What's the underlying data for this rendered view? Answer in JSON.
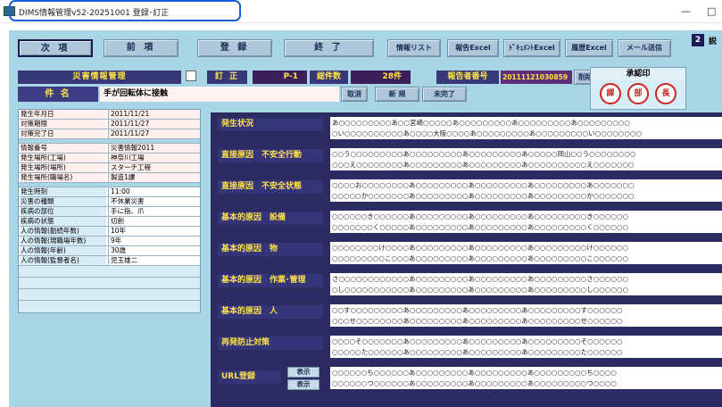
{
  "window": {
    "title": "DIMS情報管理v52-20251001 登録･訂正",
    "minimize": "—",
    "maximize": "□"
  },
  "toolbar": {
    "next": "次 項",
    "prev": "前 項",
    "register": "登 録",
    "end": "終 了",
    "info_list": "情報リスト",
    "report_excel": "報告Excel",
    "document_excel": "ﾄﾞｷｭﾒﾝﾄExcel",
    "history_excel": "履歴Excel",
    "send_mail": "メール送信",
    "badge": "2",
    "side_label": "説"
  },
  "header": {
    "title": "災害情報管理",
    "correct_label": "訂 正",
    "page": "P-1",
    "total_label": "総件数",
    "total_value": "28件",
    "report_no_label": "報告者番号",
    "report_no_value": "20111121030859",
    "delete_button": "削除"
  },
  "approval": {
    "title": "承認印",
    "stamps": [
      "課",
      "部",
      "長"
    ]
  },
  "subject": {
    "label": "件 名",
    "value": "手が回転体に接触",
    "cancel": "取消",
    "new": "新 規",
    "incomplete": "未完了"
  },
  "info": {
    "dates": [
      {
        "key": "発生年月日",
        "value": "2011/11/21"
      },
      {
        "key": "対策期限",
        "value": "2011/11/27"
      },
      {
        "key": "対策完了日",
        "value": "2011/11/27"
      }
    ],
    "location": [
      {
        "key": "情報番号",
        "value": "災害情報2011"
      },
      {
        "key": "発生場所(工場)",
        "value": "神奈川工場"
      },
      {
        "key": "発生場所(場所)",
        "value": "スターチ工程"
      },
      {
        "key": "発生場所(職場名)",
        "value": "製造1課"
      }
    ],
    "details": [
      {
        "key": "発生時刻",
        "value": "11:00"
      },
      {
        "key": "災害の種類",
        "value": "不休業災害"
      },
      {
        "key": "疾病の部位",
        "value": "手に指、爪"
      },
      {
        "key": "疾病の状態",
        "value": "切創"
      },
      {
        "key": "人の情報(勤続年数)",
        "value": "10年"
      },
      {
        "key": "人の情報(現職場年数)",
        "value": "9年"
      },
      {
        "key": "人の情報(年齢)",
        "value": "30歳"
      },
      {
        "key": "人の情報(監督者名)",
        "value": "児玉雄二"
      }
    ]
  },
  "sections": [
    {
      "label": "発生状況",
      "lines": [
        "あ○○○○○○○○○あ○○宮崎○○○○○あ○○○○○○○○○あ○○○○○○○○○あ○○○○○○○○○",
        "○い○○○○○○○○○○あ○○○○大阪○○○○あ○○○○○○○○○あ○○○○○○○○○い○○○○○○○○"
      ]
    },
    {
      "label": "直接原因　不安全行動",
      "lines": [
        "○○う○○○○○○○○○あ○○○○○○○○○あ○○○○○○○○○あ○○○○○岡山○○う○○○○○○○○",
        "○○○え○○○○○○○○あ○○○○○○○○○あ○○○○○○○○○あ○○○○○○○○○○え○○○○○○○"
      ]
    },
    {
      "label": "直接原因　不安全状態",
      "lines": [
        "○○○○お○○○○○○○○あ○○○○○○○○○あ○○○○○○○○○あ○○○○○○○○○あ○○○○○○○",
        "○○○○○か○○○○○○○あ○○○○○○○○○あ○○○○○○○○○あ○○○○○○○○○か○○○○○○○"
      ]
    },
    {
      "label": "基本的原因　設備",
      "lines": [
        "○○○○○○き○○○○○○あ○○○○○○○○○あ○○○○○○○○○あ○○○○○○○○○き○○○○○○",
        "○○○○○○○く○○○○○あ○○○○○○○○○あ○○○○○○○○○あ○○○○○○○○○く○○○○○○"
      ]
    },
    {
      "label": "基本的原因　物",
      "lines": [
        "○○○○○○○○け○○○○あ○○○○○○○○○あ○○○○○○○○○あ○○○○○○○○○け○○○○○○",
        "○○○○○○○○○こ○○○あ○○○○○○○○○あ○○○○○○○○○あ○○○○○○○○○こ○○○○○○"
      ]
    },
    {
      "label": "基本的原因　作業･管理",
      "lines": [
        "さ○○○○○○○○○○○○あ○○○○○○○○○あ○○○○○○○○○あ○○○○○○○○○さ○○○○○○",
        "○し○○○○○○○○○○○あ○○○○○○○○○あ○○○○○○○○○あ○○○○○○○○○し○○○○○○"
      ]
    },
    {
      "label": "基本的原因　人",
      "lines": [
        "○○す○○○○○○○○○あ○○○○○○○○○あ○○○○○○○○○あ○○○○○○○○○す○○○○○○",
        "○○○せ○○○○○○○○あ○○○○○○○○○あ○○○○○○○○○あ○○○○○○○○○せ○○○○○○"
      ]
    },
    {
      "label": "再発防止対策",
      "lines": [
        "○○○○そ○○○○○○○あ○○○○○○○○○あ○○○○○○○○○あ○○○○○○○○○そ○○○○○○",
        "○○○○○た○○○○○○あ○○○○○○○○○あ○○○○○○○○○あ○○○○○○○○○た○○○○○○"
      ]
    }
  ],
  "url": {
    "label": "URL登録",
    "show1": "表示",
    "show2": "表示",
    "lines": [
      "○○○○○○ち○○○○○○あ○○○○○○○○○あ○○○○○○○○○あ○○○○○○○○○ち○○○○",
      "○○○○○○つ○○○○○○あ○○○○○○○○○あ○○○○○○○○○あ○○○○○○○○○つ○○○○"
    ]
  }
}
